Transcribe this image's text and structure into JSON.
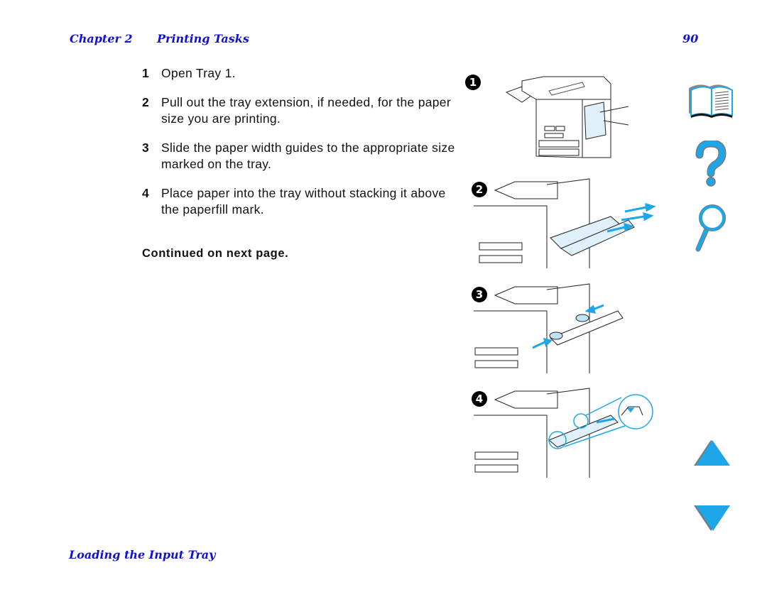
{
  "header": {
    "chapter": "Chapter 2",
    "title": "Printing Tasks",
    "page_number": "90"
  },
  "steps": [
    {
      "number": "1",
      "text": "Open Tray 1."
    },
    {
      "number": "2",
      "text": "Pull out the tray extension, if needed, for the paper size you are printing."
    },
    {
      "number": "3",
      "text": "Slide the paper width guides to the appropriate size marked on the tray."
    },
    {
      "number": "4",
      "text": "Place paper into the tray without stacking it above the paperfill mark."
    }
  ],
  "continued_label": "Continued on next page.",
  "figures": [
    {
      "badge": "1",
      "description": "printer-tray1-opening"
    },
    {
      "badge": "2",
      "description": "tray-extension-pull-out"
    },
    {
      "badge": "3",
      "description": "paper-width-guides-slide"
    },
    {
      "badge": "4",
      "description": "paper-fill-mark-detail"
    }
  ],
  "footer": {
    "link": "Loading the Input Tray"
  },
  "nav": {
    "contents_icon": "book-icon",
    "help_icon": "question-mark-icon",
    "search_icon": "magnifier-icon",
    "prev_icon": "up-triangle-icon",
    "next_icon": "down-triangle-icon"
  },
  "colors": {
    "header_text": "#1010d8",
    "accent_blue": "#1ea7e8",
    "shadow_gray": "#7a7a7a"
  }
}
